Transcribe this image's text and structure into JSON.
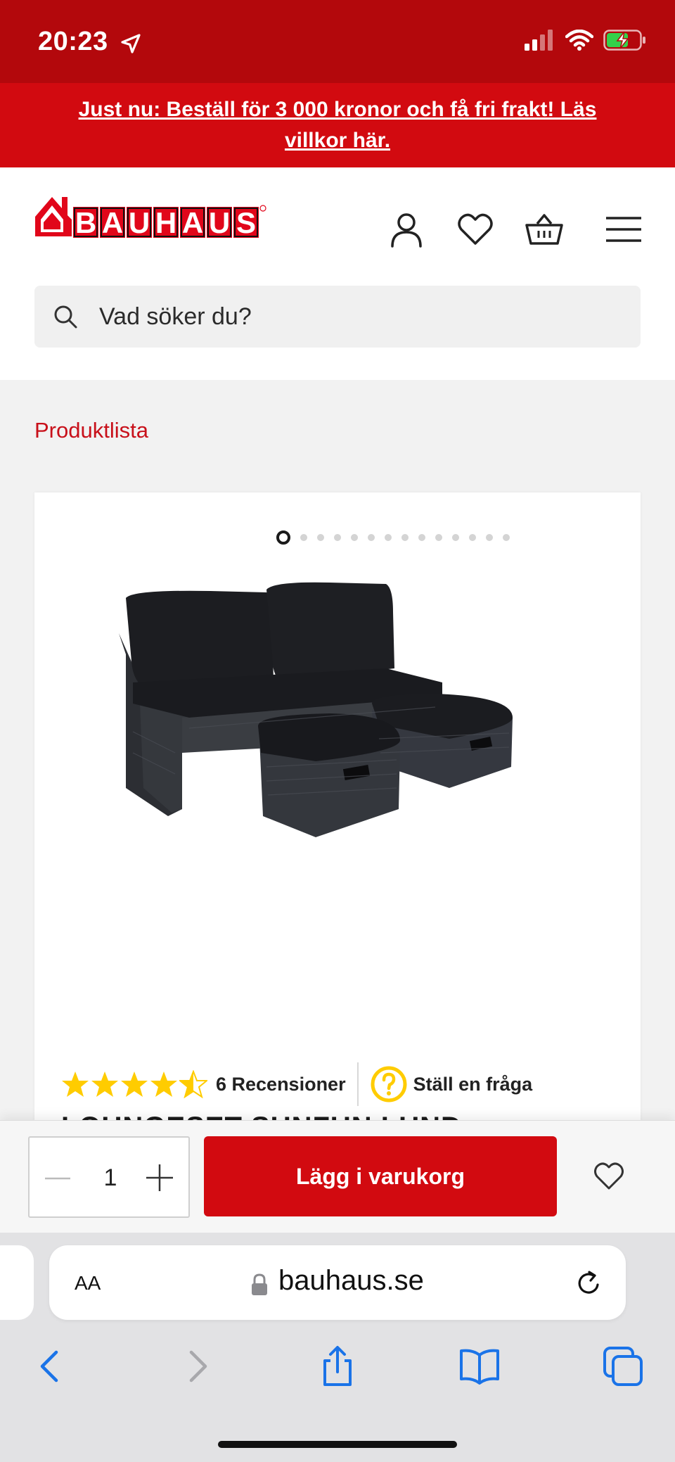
{
  "status_bar": {
    "time": "20:23"
  },
  "promo": {
    "text": "Just nu: Beställ för 3 000 kronor och få fri frakt! Läs villkor här."
  },
  "header": {
    "logo_text": "BAUHAUS",
    "icons": [
      "user-icon",
      "heart-icon",
      "basket-icon",
      "menu-icon"
    ]
  },
  "search": {
    "placeholder": "Vad söker du?"
  },
  "breadcrumb": {
    "label": "Produktlista"
  },
  "product": {
    "image_count": 14,
    "active_image": 1,
    "rating": 4.5,
    "reviews_label": "6 Recensioner",
    "ask_label": "Ställ en fråga",
    "title_partial": "LOUNGESET SUNFUN LUND"
  },
  "cart_bar": {
    "quantity": "1",
    "add_label": "Lägg i varukorg"
  },
  "browser": {
    "aa_label": "AA",
    "url": "bauhaus.se"
  },
  "colors": {
    "brand_red": "#d20a10",
    "status_red": "#b3080c",
    "link_red": "#c8101a",
    "ios_blue": "#1a73e8",
    "star_yellow": "#ffcc00"
  }
}
